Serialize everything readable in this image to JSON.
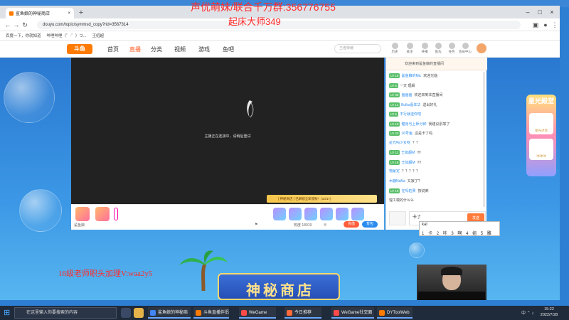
{
  "browser": {
    "tab_title": "鲨鱼娘的神秘商店",
    "url": "douyu.com/topic/symmsd_copy?rid=3567314",
    "bookmarks": [
      "百度一下，你就知道",
      "哔哩哔哩（゜-゜）つ...",
      "王绍超"
    ]
  },
  "site": {
    "logo": "斗鱼",
    "nav": [
      "首页",
      "直播",
      "分类",
      "视频",
      "游戏",
      "鱼吧"
    ],
    "search_placeholder": "王者荣耀",
    "top_icons": [
      "历史",
      "关注",
      "开播",
      "鱼丸",
      "任务",
      "会员中心"
    ]
  },
  "player": {
    "loading_text": "主播正在连接中，请稍后重试",
    "gold_banner": "[ 神秘商店 ] 已解锁全新皮肤！(10/17)",
    "hot_label": "热度 18019",
    "toolbar_left": "鲨鱼娘",
    "btn_red": "充值",
    "btn_blue": "背包"
  },
  "chat": {
    "header": "欢迎来到鲨鱼娘的直播间",
    "messages": [
      {
        "lv": "LV 16",
        "name": "鲨鱼娘的Mic",
        "text": "欢迎光临"
      },
      {
        "lv": "LV 6",
        "name": "",
        "text": "一天 理解"
      },
      {
        "lv": "LV 30",
        "name": "画画画",
        "text": "欢迎来到本直播间"
      },
      {
        "lv": "LV 11",
        "name": "Bulks嘉年华",
        "text": "送出好礼"
      },
      {
        "lv": "LV 5",
        "name": "不行就送你吧",
        "text": ""
      },
      {
        "lv": "LV 10",
        "name": "健身与上师分钟",
        "text": "我建议别等了"
      },
      {
        "lv": "LV 23",
        "name": "16号鱼",
        "text": "这是卡了吗"
      },
      {
        "lv": "",
        "name": "星光吗少女呀",
        "text": "？？"
      },
      {
        "lv": "LV 11",
        "name": "王如超M",
        "text": "!!!!"
      },
      {
        "lv": "LV 18",
        "name": "王如超M",
        "text": "!!!!"
      },
      {
        "lv": "",
        "name": "物蒙定",
        "text": "？？？？？"
      },
      {
        "lv": "",
        "name": "木鹿NaNa",
        "text": "又寂了?"
      },
      {
        "lv": "LV 10",
        "name": "在吗粒果",
        "text": "按说倒"
      },
      {
        "lv": "",
        "name": "",
        "text": "理工模的什么么"
      }
    ],
    "input_value": "卡了",
    "send_label": "发送"
  },
  "ime": {
    "composition": "kal",
    "candidates": [
      "1 卡",
      "2 咔",
      "3 啊",
      "4 姐",
      "5 雕"
    ]
  },
  "promo": {
    "title": "星光殿堂",
    "cards": [
      "星光点亮",
      "冲冲冲"
    ]
  },
  "shop_banner": "神秘商店",
  "overlays": {
    "top_line": "声优萌妹/联合千万群:356776755",
    "second_line": "起床大师349",
    "left_line": "16级老师职头加理V:waa2y5"
  },
  "taskbar": {
    "search_placeholder": "在这里输入你要搜索的内容",
    "apps": [
      "鲨鱼娘的神秘商店",
      "斗鱼直播伴侣",
      "WeGame",
      "今日推荐",
      "WeGame社交面板",
      "DYToolWeb"
    ],
    "time": "15:22",
    "date": "2022/7/28"
  },
  "colors": {
    "accent": "#ff7a00",
    "stage_blue": "#2a78d0",
    "overlay_red": "#ff2a2a"
  }
}
